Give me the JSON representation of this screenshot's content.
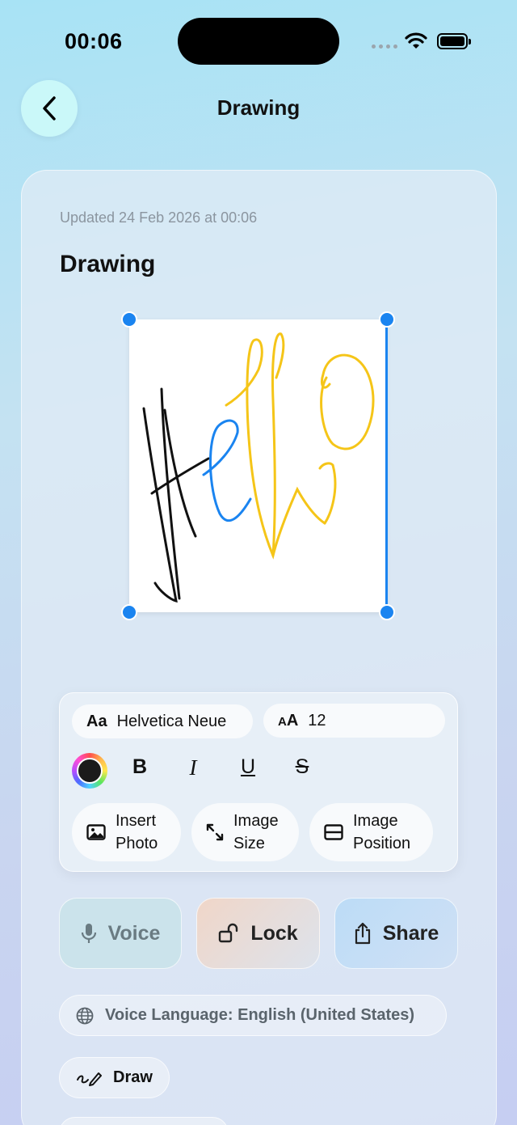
{
  "status": {
    "time": "00:06"
  },
  "nav": {
    "title": "Drawing"
  },
  "note": {
    "updated": "Updated 24 Feb 2026 at 00:06",
    "title": "Drawing"
  },
  "format": {
    "font_lead": "Aa",
    "font_name": "Helvetica Neue",
    "size_lead": "AA",
    "size_value": "12",
    "bold": "B",
    "italic": "I",
    "underline": "U",
    "strike": "S",
    "current_color": "#1b1b1b"
  },
  "image_actions": {
    "insert_photo": "Insert Photo",
    "image_size": "Image Size",
    "image_position": "Image Position"
  },
  "actions": {
    "voice": "Voice",
    "lock": "Lock",
    "share": "Share"
  },
  "voice_language": "Voice Language: English (United States)",
  "draw": "Draw",
  "colors": {
    "accent": "#1a84f0",
    "ink_black": "#111111",
    "ink_blue": "#1a84f0",
    "ink_yellow": "#f5c518"
  },
  "icons": [
    "chevron-left-icon",
    "wifi-icon",
    "battery-icon",
    "photo-icon",
    "resize-icon",
    "position-icon",
    "microphone-icon",
    "unlock-icon",
    "share-icon",
    "globe-icon",
    "pen-icon"
  ]
}
